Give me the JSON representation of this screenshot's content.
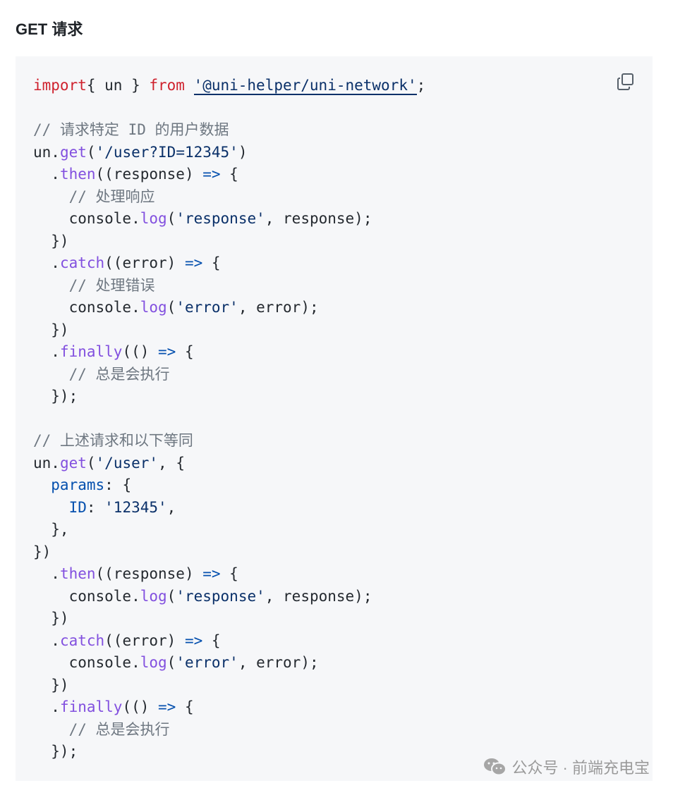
{
  "heading": "GET 请求",
  "copy_icon": "copy-icon",
  "colors": {
    "keyword": "#cf222e",
    "function": "#8250df",
    "string": "#0a3069",
    "operator": "#0550ae",
    "comment": "#6e7781",
    "text": "#24292f",
    "background": "#f6f7f9"
  },
  "code_lines": [
    [
      [
        "kw",
        "import"
      ],
      [
        "",
        "{ un } "
      ],
      [
        "kw",
        "from"
      ],
      [
        "",
        ""
      ],
      [
        "str link",
        "'@uni-helper/uni-network'"
      ],
      [
        "",
        ";"
      ]
    ],
    [],
    [
      [
        "cm",
        "// 请求特定 ID 的用户数据"
      ]
    ],
    [
      [
        "",
        "un."
      ],
      [
        "fn",
        "get"
      ],
      [
        "",
        "("
      ],
      [
        "str",
        "'/user?ID=12345'"
      ],
      [
        "",
        ")"
      ]
    ],
    [
      [
        "",
        "  ."
      ],
      [
        "fn",
        "then"
      ],
      [
        "",
        "((response) "
      ],
      [
        "op",
        "=>"
      ],
      [
        "",
        "",
        " {"
      ]
    ],
    [
      [
        "cm",
        "    // 处理响应"
      ]
    ],
    [
      [
        "",
        "    console."
      ],
      [
        "fn",
        "log"
      ],
      [
        "",
        "("
      ],
      [
        "str",
        "'response'"
      ],
      [
        "",
        ", response);"
      ]
    ],
    [
      [
        "",
        "  })"
      ]
    ],
    [
      [
        "",
        "  ."
      ],
      [
        "fn",
        "catch"
      ],
      [
        "",
        "((error) "
      ],
      [
        "op",
        "=>"
      ],
      [
        "",
        "",
        " {"
      ]
    ],
    [
      [
        "cm",
        "    // 处理错误"
      ]
    ],
    [
      [
        "",
        "    console."
      ],
      [
        "fn",
        "log"
      ],
      [
        "",
        "("
      ],
      [
        "str",
        "'error'"
      ],
      [
        "",
        ", error);"
      ]
    ],
    [
      [
        "",
        "  })"
      ]
    ],
    [
      [
        "",
        "  ."
      ],
      [
        "fn",
        "finally"
      ],
      [
        "",
        "(() "
      ],
      [
        "op",
        "=>"
      ],
      [
        "",
        "",
        " {"
      ]
    ],
    [
      [
        "cm",
        "    // 总是会执行"
      ]
    ],
    [
      [
        "",
        "  });"
      ]
    ],
    [],
    [
      [
        "cm",
        "// 上述请求和以下等同"
      ]
    ],
    [
      [
        "",
        "un."
      ],
      [
        "fn",
        "get"
      ],
      [
        "",
        "("
      ],
      [
        "str",
        "'/user'"
      ],
      [
        "",
        ", {"
      ]
    ],
    [
      [
        "op",
        "  params"
      ],
      [
        "",
        ": {"
      ]
    ],
    [
      [
        "op",
        "    ID"
      ],
      [
        "",
        ": "
      ],
      [
        "str",
        "'12345'"
      ],
      [
        "",
        ","
      ]
    ],
    [
      [
        "",
        "  },"
      ]
    ],
    [
      [
        "",
        "})"
      ]
    ],
    [
      [
        "",
        "  ."
      ],
      [
        "fn",
        "then"
      ],
      [
        "",
        "((response) "
      ],
      [
        "op",
        "=>"
      ],
      [
        "",
        "",
        " {"
      ]
    ],
    [
      [
        "",
        "    console."
      ],
      [
        "fn",
        "log"
      ],
      [
        "",
        "("
      ],
      [
        "str",
        "'response'"
      ],
      [
        "",
        ", response);"
      ]
    ],
    [
      [
        "",
        "  })"
      ]
    ],
    [
      [
        "",
        "  ."
      ],
      [
        "fn",
        "catch"
      ],
      [
        "",
        "((error) "
      ],
      [
        "op",
        "=>"
      ],
      [
        "",
        "",
        " {"
      ]
    ],
    [
      [
        "",
        "    console."
      ],
      [
        "fn",
        "log"
      ],
      [
        "",
        "("
      ],
      [
        "str",
        "'error'"
      ],
      [
        "",
        ", error);"
      ]
    ],
    [
      [
        "",
        "  })"
      ]
    ],
    [
      [
        "",
        "  ."
      ],
      [
        "fn",
        "finally"
      ],
      [
        "",
        "(() "
      ],
      [
        "op",
        "=>"
      ],
      [
        "",
        "",
        " {"
      ]
    ],
    [
      [
        "cm",
        "    // 总是会执行"
      ]
    ],
    [
      [
        "",
        "  });"
      ]
    ]
  ],
  "watermark": {
    "icon": "wechat-icon",
    "text": "公众号 · 前端充电宝"
  }
}
